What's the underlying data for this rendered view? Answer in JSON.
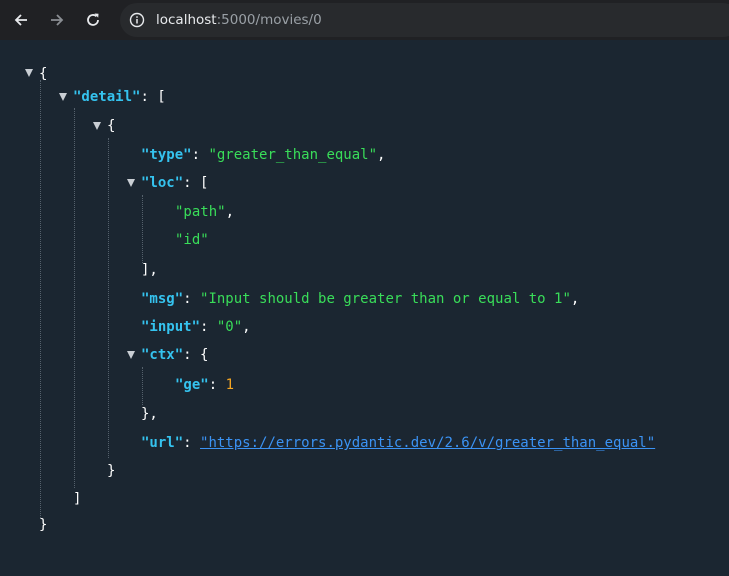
{
  "browser": {
    "url_host": "localhost",
    "url_path": ":5000/movies/0",
    "icons": {
      "back": "back-arrow-icon",
      "forward": "forward-arrow-icon",
      "reload": "reload-icon",
      "info": "info-icon"
    }
  },
  "json": {
    "key_detail": "\"detail\"",
    "key_type": "\"type\"",
    "val_type": "\"greater_than_equal\"",
    "key_loc": "\"loc\"",
    "loc_0": "\"path\"",
    "loc_1": "\"id\"",
    "key_msg": "\"msg\"",
    "val_msg": "\"Input should be greater than or equal to 1\"",
    "key_input": "\"input\"",
    "val_input": "\"0\"",
    "key_ctx": "\"ctx\"",
    "key_ge": "\"ge\"",
    "val_ge": "1",
    "key_url": "\"url\"",
    "val_url": "\"https://errors.pydantic.dev/2.6/v/greater_than_equal\""
  },
  "colors": {
    "background": "#1b2631",
    "key": "#35c3ef",
    "string": "#39dd59",
    "number": "#f5a623",
    "link": "#3b93f4"
  }
}
